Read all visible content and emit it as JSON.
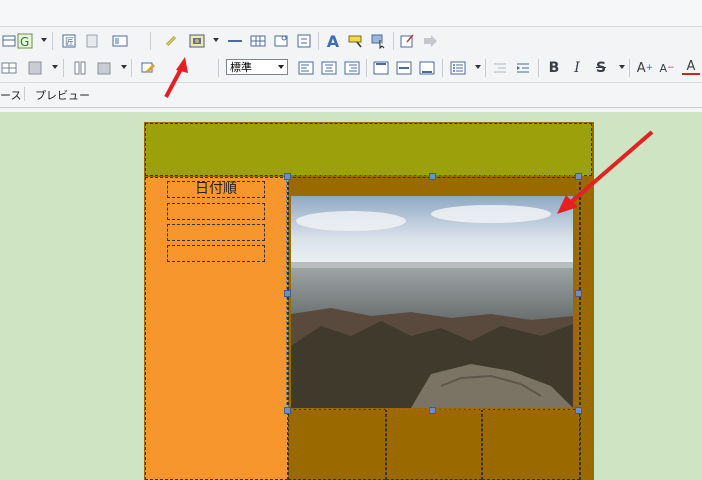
{
  "toolbar": {
    "font_style_select": "標準",
    "bold_label": "B",
    "italic_label": "I",
    "strike_label": "S",
    "format_text_a": "A",
    "grow_font_label": "A",
    "shrink_font_label": "A"
  },
  "tabs": {
    "source_tab_fragment": "ース",
    "preview_tab": "プレビュー"
  },
  "page": {
    "sidebar_title": "日付順"
  },
  "colors": {
    "header_bg": "#9ba00b",
    "sidebar_bg": "#f7962d",
    "main_frame_bg": "#9a6a00",
    "workspace_bg": "#cfe4c3",
    "annotation_arrow": "#e62020"
  },
  "annotations": {
    "arrow_1_target": "image-insert-button",
    "arrow_2_target": "inserted-photo"
  }
}
